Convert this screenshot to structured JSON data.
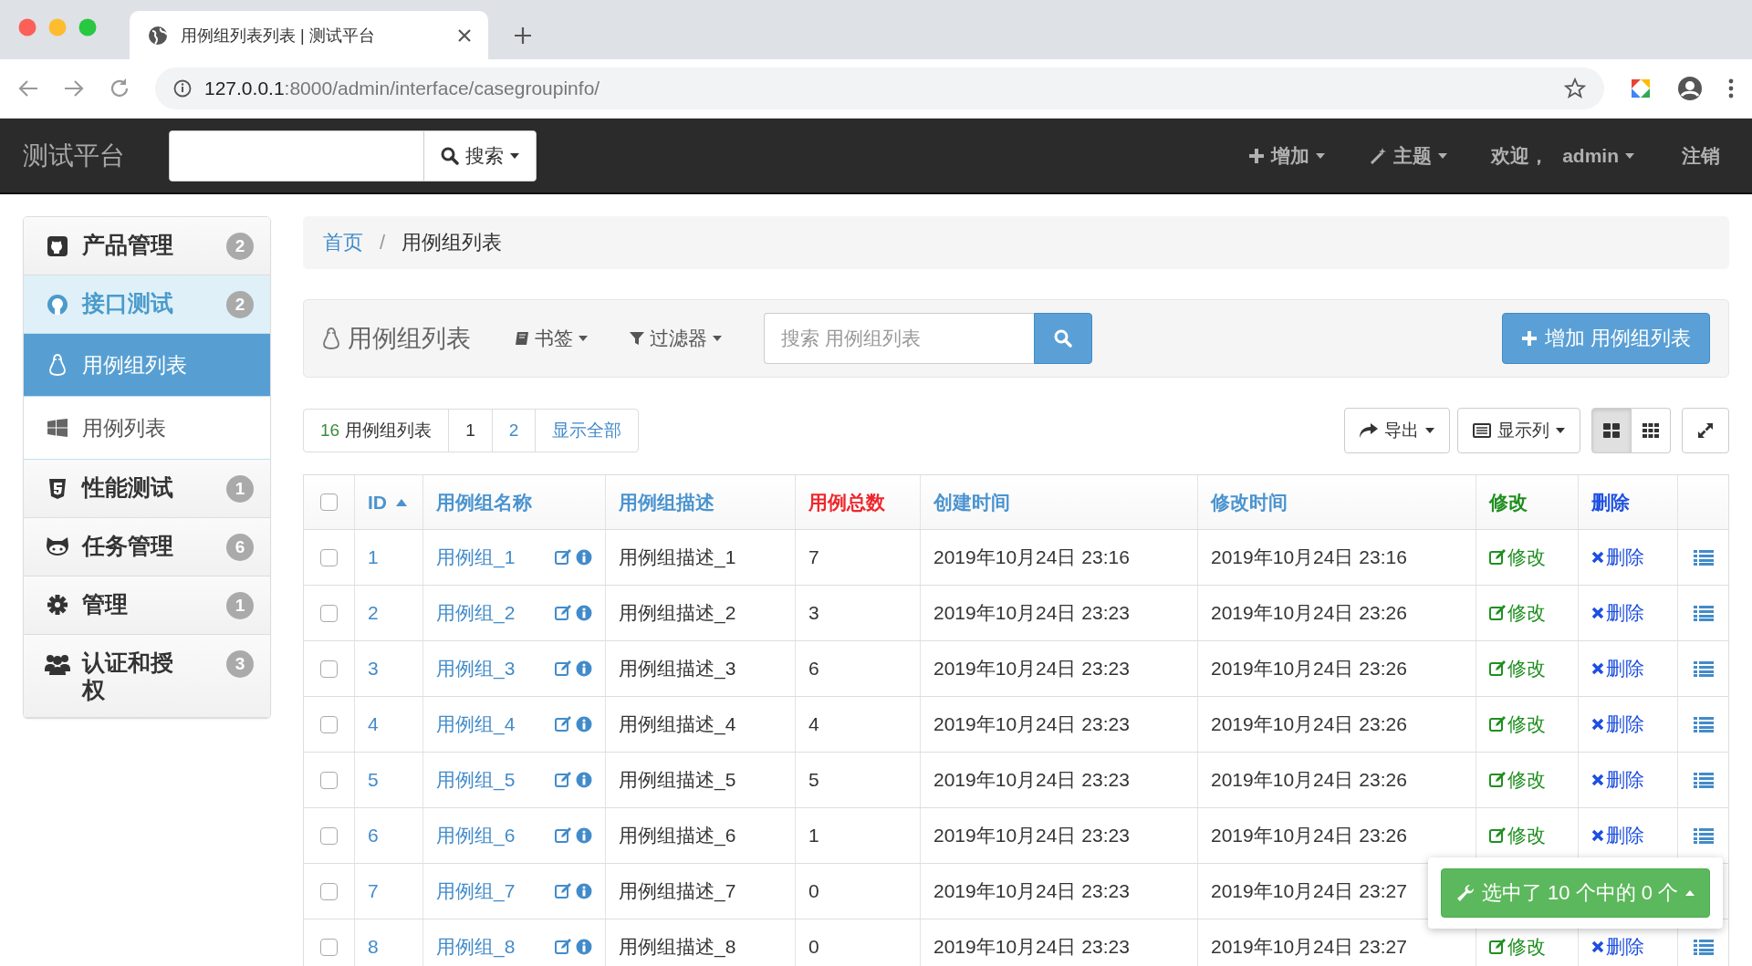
{
  "browser": {
    "tab_title": "用例组列表列表 | 测试平台",
    "url_host": "127.0.0.1",
    "url_path": ":8000/admin/interface/casegroupinfo/"
  },
  "navbar": {
    "brand": "测试平台",
    "search_button": "搜索",
    "menus": [
      {
        "label": "增加"
      },
      {
        "label": "主题"
      },
      {
        "label": "欢迎，",
        "user": "admin"
      }
    ],
    "logout": "注销"
  },
  "sidebar": {
    "items": [
      {
        "label": "产品管理",
        "badge": "2",
        "expanded": false
      },
      {
        "label": "接口测试",
        "badge": "2",
        "expanded": true,
        "children": [
          {
            "label": "用例组列表",
            "selected": true
          },
          {
            "label": "用例列表",
            "selected": false
          }
        ]
      },
      {
        "label": "性能测试",
        "badge": "1",
        "expanded": false
      },
      {
        "label": "任务管理",
        "badge": "6",
        "expanded": false
      },
      {
        "label": "管理",
        "badge": "1",
        "expanded": false
      },
      {
        "label": "认证和授权",
        "badge": "3",
        "expanded": false
      }
    ]
  },
  "breadcrumb": {
    "separator": "/",
    "items": [
      {
        "label": "首页",
        "link": true
      },
      {
        "label": "用例组列表",
        "link": false
      }
    ]
  },
  "panel": {
    "title": "用例组列表",
    "bookmarks": "书签",
    "filter": "过滤器",
    "search_placeholder": "搜索 用例组列表",
    "add_button": "增加 用例组列表"
  },
  "pagination": {
    "count": "16",
    "count_label": "用例组列表",
    "pages": [
      {
        "label": "1",
        "selected": true
      },
      {
        "label": "2",
        "selected": false
      }
    ],
    "show_all": "显示全部"
  },
  "toolbar": {
    "export": "导出",
    "columns": "显示列",
    "view_modes": [
      {
        "selected": true
      },
      {
        "selected": false
      }
    ]
  },
  "table": {
    "select_all_checked": false,
    "columns": [
      {
        "label": "ID",
        "sorted": true,
        "color": "#4a93cf"
      },
      {
        "label": "用例组名称",
        "sorted": false,
        "color": "#4a93cf"
      },
      {
        "label": "用例组描述",
        "sorted": false,
        "color": "#4a93cf"
      },
      {
        "label": "用例总数",
        "sorted": false,
        "color": "#f0262b"
      },
      {
        "label": "创建时间",
        "sorted": false,
        "color": "#4a93cf"
      },
      {
        "label": "修改时间",
        "sorted": false,
        "color": "#4a93cf"
      },
      {
        "label": "修改",
        "sorted": false,
        "color": "#1f8f1f"
      },
      {
        "label": "删除",
        "sorted": false,
        "color": "#1d4fe0"
      }
    ],
    "rows": [
      {
        "checked": false,
        "id": "1",
        "name": "用例组_1",
        "description": "用例组描述_1",
        "total": "7",
        "created": "2019年10月24日 23:16",
        "modified": "2019年10月24日 23:16",
        "edit": "修改",
        "delete": "删除"
      },
      {
        "checked": false,
        "id": "2",
        "name": "用例组_2",
        "description": "用例组描述_2",
        "total": "3",
        "created": "2019年10月24日 23:23",
        "modified": "2019年10月24日 23:26",
        "edit": "修改",
        "delete": "删除"
      },
      {
        "checked": false,
        "id": "3",
        "name": "用例组_3",
        "description": "用例组描述_3",
        "total": "6",
        "created": "2019年10月24日 23:23",
        "modified": "2019年10月24日 23:26",
        "edit": "修改",
        "delete": "删除"
      },
      {
        "checked": false,
        "id": "4",
        "name": "用例组_4",
        "description": "用例组描述_4",
        "total": "4",
        "created": "2019年10月24日 23:23",
        "modified": "2019年10月24日 23:26",
        "edit": "修改",
        "delete": "删除"
      },
      {
        "checked": false,
        "id": "5",
        "name": "用例组_5",
        "description": "用例组描述_5",
        "total": "5",
        "created": "2019年10月24日 23:23",
        "modified": "2019年10月24日 23:26",
        "edit": "修改",
        "delete": "删除"
      },
      {
        "checked": false,
        "id": "6",
        "name": "用例组_6",
        "description": "用例组描述_6",
        "total": "1",
        "created": "2019年10月24日 23:23",
        "modified": "2019年10月24日 23:26",
        "edit": "修改",
        "delete": "删除"
      },
      {
        "checked": false,
        "id": "7",
        "name": "用例组_7",
        "description": "用例组描述_7",
        "total": "0",
        "created": "2019年10月24日 23:23",
        "modified": "2019年10月24日 23:27"
      },
      {
        "checked": false,
        "id": "8",
        "name": "用例组_8",
        "description": "用例组描述_8",
        "total": "0",
        "created": "2019年10月24日 23:23",
        "modified": "2019年10月24日 23:27",
        "edit": "修改",
        "delete": "删除"
      }
    ]
  },
  "action_bar": {
    "label": "选中了 10 个中的 0 个"
  }
}
